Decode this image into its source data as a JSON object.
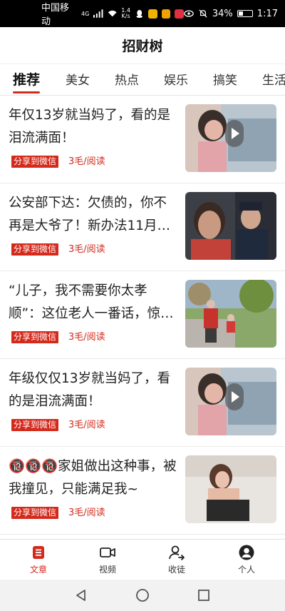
{
  "status_bar": {
    "carrier": "中国移动",
    "network": "4G",
    "speed_value": "1.4",
    "speed_unit": "K/s",
    "battery": "34%",
    "battery_level": 0.34,
    "time": "1:17",
    "app_icon_colors": [
      "#e63a3a",
      "#f0b400",
      "#f0a000",
      "#e03040"
    ]
  },
  "app": {
    "title": "招财树"
  },
  "tabs": [
    {
      "label": "推荐",
      "active": true
    },
    {
      "label": "美女",
      "active": false
    },
    {
      "label": "热点",
      "active": false
    },
    {
      "label": "娱乐",
      "active": false
    },
    {
      "label": "搞笑",
      "active": false
    },
    {
      "label": "生活",
      "active": false
    }
  ],
  "articles": [
    {
      "title": "年仅13岁就当妈了，看的是泪流满面！",
      "share_label": "分享到微信",
      "reward": "3毛/阅读",
      "thumb": "video-thumbnail-girl"
    },
    {
      "title": "公安部下达：欠债的，你不再是大爷了！新办法11月…",
      "share_label": "分享到微信",
      "reward": "3毛/阅读",
      "thumb": "photo-police-woman"
    },
    {
      "title": "“儿子，我不需要你太孝顺”：这位老人一番话，惊…",
      "share_label": "分享到微信",
      "reward": "3毛/阅读",
      "thumb": "photo-elder-child-park"
    },
    {
      "title": "年级仅仅13岁就当妈了，看的是泪流满面！",
      "share_label": "分享到微信",
      "reward": "3毛/阅读",
      "thumb": "video-thumbnail-girl"
    },
    {
      "title": "🔞🔞🔞家姐做出这种事，被我撞见，只能满足我~",
      "share_label": "分享到微信",
      "reward": "3毛/阅读",
      "thumb": "photo-woman-lingerie"
    }
  ],
  "bottom_nav": [
    {
      "label": "文章",
      "icon": "article-icon",
      "active": true
    },
    {
      "label": "视频",
      "icon": "video-icon",
      "active": false
    },
    {
      "label": "收徒",
      "icon": "apprentice-icon",
      "active": false
    },
    {
      "label": "个人",
      "icon": "profile-icon",
      "active": false
    }
  ],
  "colors": {
    "accent": "#d42a1c"
  }
}
